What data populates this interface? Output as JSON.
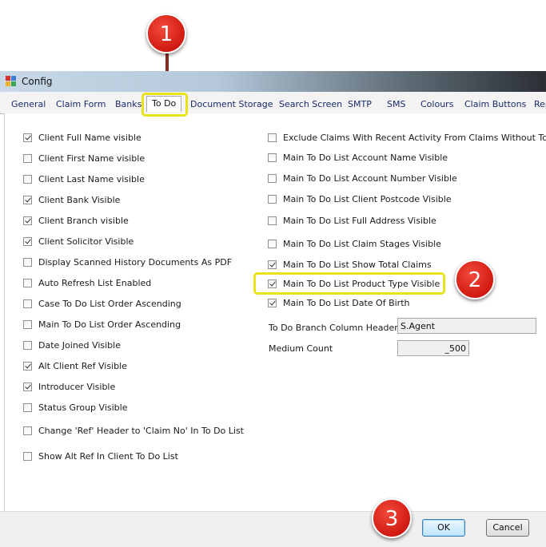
{
  "window": {
    "title": "Config"
  },
  "tabs": [
    {
      "label": "General"
    },
    {
      "label": "Claim Form"
    },
    {
      "label": "Banks"
    },
    {
      "label": "To Do"
    },
    {
      "label": "Document Storage"
    },
    {
      "label": "Search Screen"
    },
    {
      "label": "SMTP"
    },
    {
      "label": "SMS"
    },
    {
      "label": "Colours"
    },
    {
      "label": "Claim Buttons"
    },
    {
      "label": "Rep"
    }
  ],
  "left_options": [
    {
      "label": "Client Full Name visible",
      "checked": true
    },
    {
      "label": "Client First Name visible",
      "checked": false
    },
    {
      "label": "Client Last Name visible",
      "checked": false
    },
    {
      "label": "Client Bank Visible",
      "checked": true
    },
    {
      "label": "Client Branch visible",
      "checked": true
    },
    {
      "label": "Client Solicitor Visible",
      "checked": true
    },
    {
      "label": "Display Scanned History Documents As PDF",
      "checked": false
    },
    {
      "label": "Auto Refresh List Enabled",
      "checked": false
    },
    {
      "label": "Case To Do List Order Ascending",
      "checked": false
    },
    {
      "label": "Main To Do List Order Ascending",
      "checked": false
    },
    {
      "label": "Date Joined Visible",
      "checked": false
    },
    {
      "label": "Alt Client Ref Visible",
      "checked": true
    },
    {
      "label": "Introducer Visible",
      "checked": true
    },
    {
      "label": "Status Group  Visible",
      "checked": false
    },
    {
      "label": "Change 'Ref' Header to 'Claim No' In To Do List",
      "checked": false
    },
    {
      "label": "Show Alt Ref In Client To Do List",
      "checked": false
    }
  ],
  "right_options": [
    {
      "label": "Exclude Claims With Recent Activity From Claims Without To Dos",
      "checked": false
    },
    {
      "label": "Main To Do List Account Name Visible",
      "checked": false
    },
    {
      "label": "Main To Do List Account Number Visible",
      "checked": false
    },
    {
      "label": "Main To Do List Client Postcode Visible",
      "checked": false
    },
    {
      "label": "Main To Do List Full Address Visible",
      "checked": false
    },
    {
      "label": "Main To Do List Claim Stages Visible",
      "checked": false
    },
    {
      "label": "Main To Do List Show Total Claims",
      "checked": true
    },
    {
      "label": "Main To Do List Product Type Visible",
      "checked": true
    },
    {
      "label": "Main To Do List Date Of Birth",
      "checked": true
    }
  ],
  "fields": {
    "branch_header_label": "To Do Branch Column Header:",
    "branch_header_value": "S.Agent",
    "medium_count_label": "Medium Count",
    "medium_count_value": "_500"
  },
  "buttons": {
    "ok": "OK",
    "cancel": "Cancel"
  },
  "annotations": {
    "step1": "1",
    "step2": "2",
    "step3": "3"
  },
  "colors": {
    "highlight": "#e8e31a",
    "marker": "#d11a12",
    "arrow": "#8b2b1f"
  }
}
